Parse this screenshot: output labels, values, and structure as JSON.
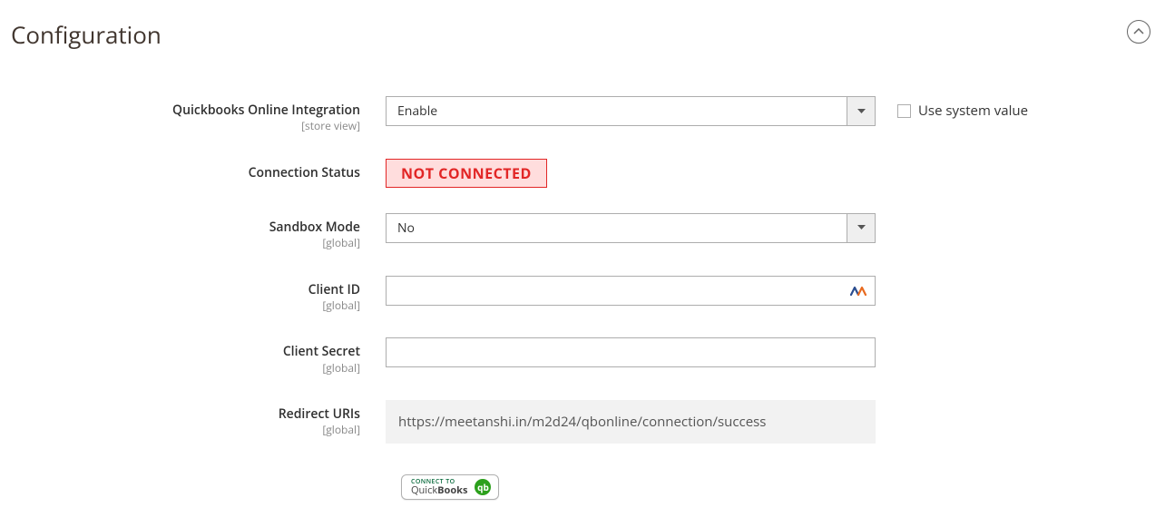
{
  "page_title": "Configuration",
  "fields": {
    "integration": {
      "label": "Quickbooks Online Integration",
      "scope": "[store view]",
      "value": "Enable",
      "use_system_label": "Use system value"
    },
    "connection_status": {
      "label": "Connection Status",
      "value": "NOT CONNECTED"
    },
    "sandbox_mode": {
      "label": "Sandbox Mode",
      "scope": "[global]",
      "value": "No"
    },
    "client_id": {
      "label": "Client ID",
      "scope": "[global]",
      "value": ""
    },
    "client_secret": {
      "label": "Client Secret",
      "scope": "[global]",
      "value": ""
    },
    "redirect_uris": {
      "label": "Redirect URIs",
      "scope": "[global]",
      "value": "https://meetanshi.in/m2d24/qbonline/connection/success"
    }
  },
  "connect_button": {
    "line1": "CONNECT TO",
    "line2_light": "Quick",
    "line2_bold": "Books",
    "glyph": "qb"
  }
}
